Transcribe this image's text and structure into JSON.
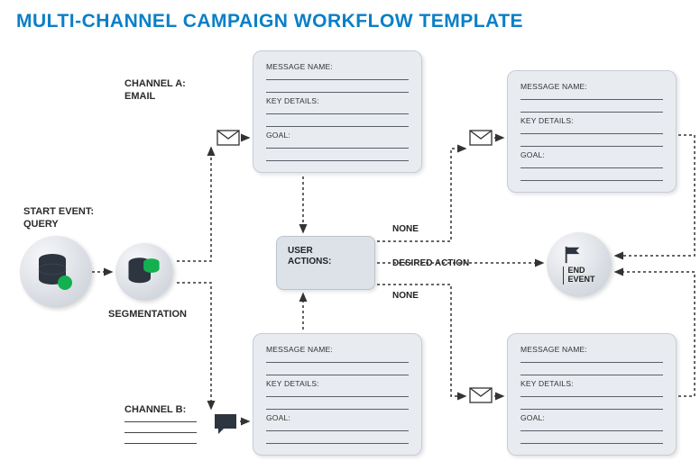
{
  "title": "MULTI-CHANNEL CAMPAIGN WORKFLOW TEMPLATE",
  "start_event": {
    "line1": "START EVENT:",
    "line2": "QUERY"
  },
  "segmentation": "SEGMENTATION",
  "channel_a": {
    "line1": "CHANNEL A:",
    "line2": "EMAIL"
  },
  "channel_b": {
    "label": "CHANNEL B:"
  },
  "user_actions": {
    "line1": "USER",
    "line2": "ACTIONS:"
  },
  "edge": {
    "none_top": "NONE",
    "desired": "DESIRED ACTION",
    "none_bottom": "NONE"
  },
  "end_event": {
    "line1": "END",
    "line2": "EVENT"
  },
  "card": {
    "msg_name": "MESSAGE NAME:",
    "key_details": "KEY DETAILS:",
    "goal": "GOAL:"
  },
  "colors": {
    "title": "#0a7fc7",
    "card_bg": "#e8ecf1",
    "accent_green": "#13b050",
    "db_dark": "#2d3540"
  }
}
